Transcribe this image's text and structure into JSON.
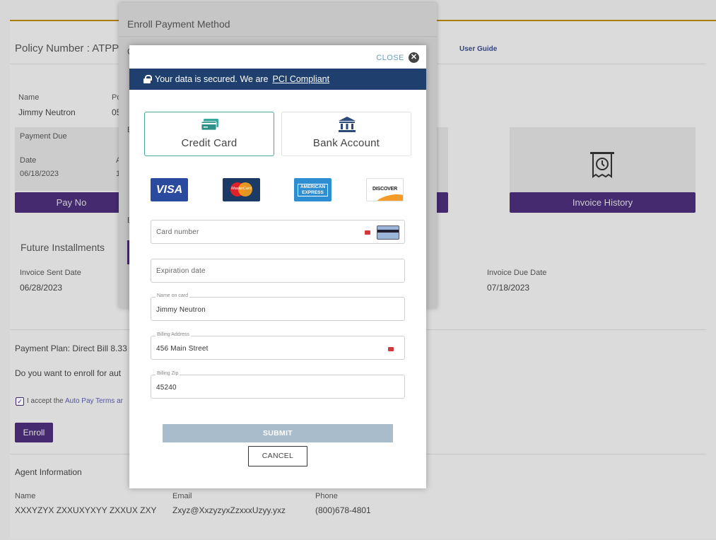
{
  "background": {
    "policy_number_label": "Policy Number : ATPP0",
    "user_guide": "User Guide",
    "name_label": "Name",
    "name_value": "Jimmy  Neutron",
    "po_label": "Po",
    "po_value": "05",
    "payment_due_label": "Payment Due",
    "date_label": "Date",
    "date_value": "06/18/2023",
    "amount_label": "A",
    "amount_value": "1",
    "pay_now": "Pay No",
    "invoice_history": "Invoice History",
    "future_installments": "Future Installments",
    "invoice_sent_date_label": "Invoice Sent Date",
    "invoice_sent_date_value": "06/28/2023",
    "invoice_due_date_label": "Invoice Due Date",
    "invoice_due_date_value": "07/18/2023",
    "payment_plan": "Payment Plan: Direct Bill 8.33",
    "enroll_question": "Do you want to enroll for aut",
    "accept_prefix": "I accept the",
    "accept_link": "Auto Pay Terms ar",
    "enroll_button": "Enroll",
    "agent_info": "Agent Information",
    "agent_name_label": "Name",
    "agent_name_value": "XXXYZYX ZXXUXYXYY ZXXUX ZXY",
    "agent_email_label": "Email",
    "agent_email_value": "Zxyz@XxzyzyxZzxxxUzyy.yxz",
    "agent_phone_label": "Phone",
    "agent_phone_value": "(800)678-4801"
  },
  "back_modal": {
    "title": "Enroll Payment Method",
    "frag_c": "C",
    "frag_e1": "E",
    "frag_e2": "E"
  },
  "modal": {
    "close_label": "CLOSE",
    "secure_text": "Your data is secured. We are",
    "secure_link": "PCI Compliant",
    "tabs": [
      {
        "label": "Credit Card",
        "active": true
      },
      {
        "label": "Bank Account",
        "active": false
      }
    ],
    "card_brands": [
      "VISA",
      "MasterCard",
      "AMERICAN EXPRESS",
      "DISCOVER"
    ],
    "fields": {
      "card_number_placeholder": "Card number",
      "expiration_placeholder": "Expiration date",
      "name_label": "Name on card",
      "name_value": "Jimmy Neutron",
      "address_label": "Billing Address",
      "address_value": "456 Main Street",
      "zip_label": "Billing Zip",
      "zip_value": "45240"
    },
    "submit_label": "SUBMIT",
    "cancel_label": "CANCEL"
  },
  "colors": {
    "secure_bar": "#1f3f6e",
    "active_tab_border": "#4aa8a0",
    "purple": "#4b2e78",
    "submit_disabled": "#a8bccb"
  }
}
